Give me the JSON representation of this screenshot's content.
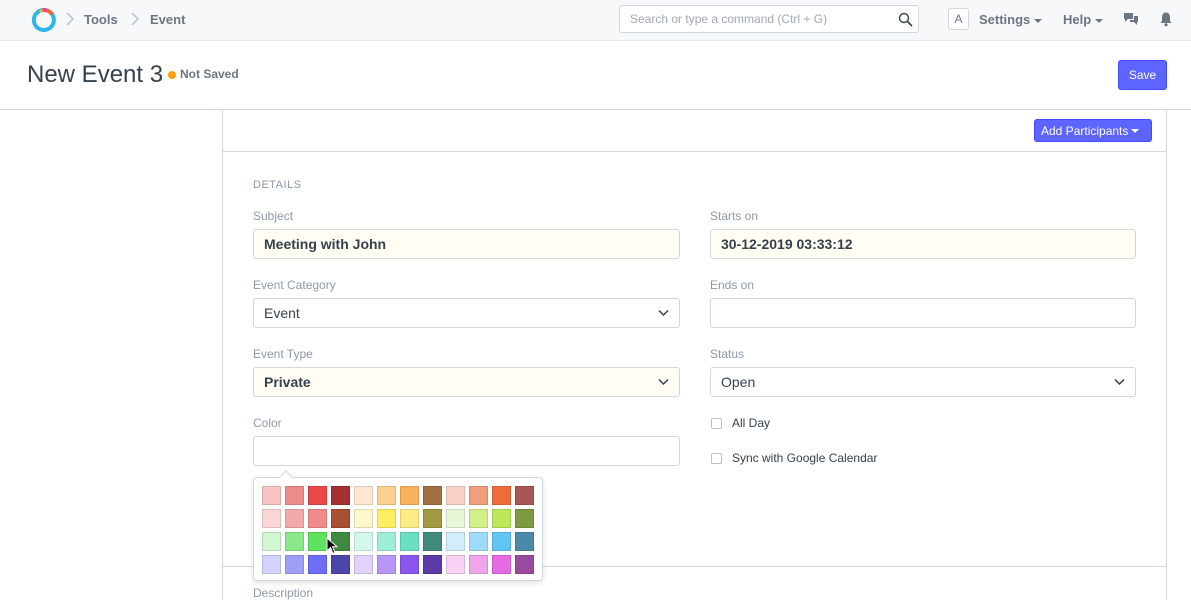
{
  "navbar": {
    "breadcrumbs": [
      "Tools",
      "Event"
    ],
    "search_placeholder": "Search or type a command (Ctrl + G)",
    "avatar_letter": "A",
    "settings_label": "Settings",
    "help_label": "Help"
  },
  "page": {
    "title": "New Event 3",
    "status": "Not Saved",
    "save_label": "Save"
  },
  "toolbar": {
    "add_participants_label": "Add Participants"
  },
  "form": {
    "section_title": "DETAILS",
    "subject": {
      "label": "Subject",
      "value": "Meeting with John"
    },
    "starts_on": {
      "label": "Starts on",
      "value": "30-12-2019 03:33:12"
    },
    "event_category": {
      "label": "Event Category",
      "value": "Event"
    },
    "ends_on": {
      "label": "Ends on",
      "value": ""
    },
    "event_type": {
      "label": "Event Type",
      "value": "Private"
    },
    "status": {
      "label": "Status",
      "value": "Open"
    },
    "color": {
      "label": "Color",
      "value": ""
    },
    "all_day_label": "All Day",
    "sync_label": "Sync with Google Calendar",
    "description_label": "Description"
  },
  "color_picker": {
    "swatches": [
      [
        "#f8c4c4",
        "#ec8a8c",
        "#ec4749",
        "#a43034",
        "#fde7d0",
        "#fdd090",
        "#f9b25c",
        "#a27041",
        "#fbd2c6",
        "#f29e7c",
        "#ef6b3c",
        "#aa5656"
      ],
      [
        "#fbd6d6",
        "#f2a9a9",
        "#ef8b8b",
        "#a75032",
        "#fef8cc",
        "#fdee61",
        "#fcec85",
        "#a19840",
        "#e8f8d6",
        "#d3ef8a",
        "#bde85a",
        "#7d9a41"
      ],
      [
        "#d2f5d2",
        "#8ae88a",
        "#5ce25c",
        "#3f8a3f",
        "#d4f8ee",
        "#9befd9",
        "#69e0c1",
        "#3f8a7a",
        "#d2edfb",
        "#9edbf8",
        "#62c4f5",
        "#4a8aa8"
      ],
      [
        "#d2d2fb",
        "#9e9ef7",
        "#6d6df5",
        "#4a47a8",
        "#e2d2fb",
        "#b796f5",
        "#8a55ef",
        "#5c3aa8",
        "#f8d2f5",
        "#f0a4ec",
        "#e66ae2",
        "#9a4a9e"
      ]
    ]
  }
}
